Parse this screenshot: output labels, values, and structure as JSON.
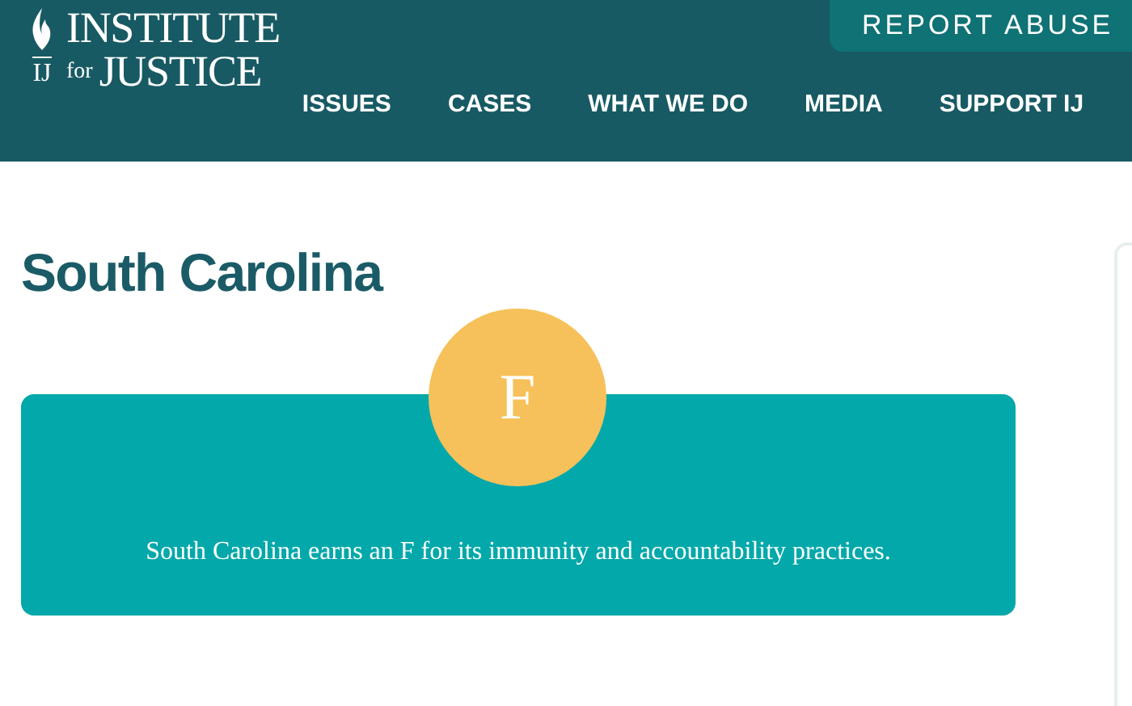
{
  "header": {
    "logo": {
      "top_line": "INSTITUTE",
      "initials": "IJ",
      "small_word": "for",
      "bottom_line": "JUSTICE"
    },
    "report_button": "REPORT ABUSE",
    "nav": [
      "ISSUES",
      "CASES",
      "WHAT WE DO",
      "MEDIA",
      "SUPPORT IJ"
    ]
  },
  "page": {
    "title": "South Carolina",
    "grade": "F",
    "summary": "South Carolina earns an F for its immunity and accountability practices."
  }
}
